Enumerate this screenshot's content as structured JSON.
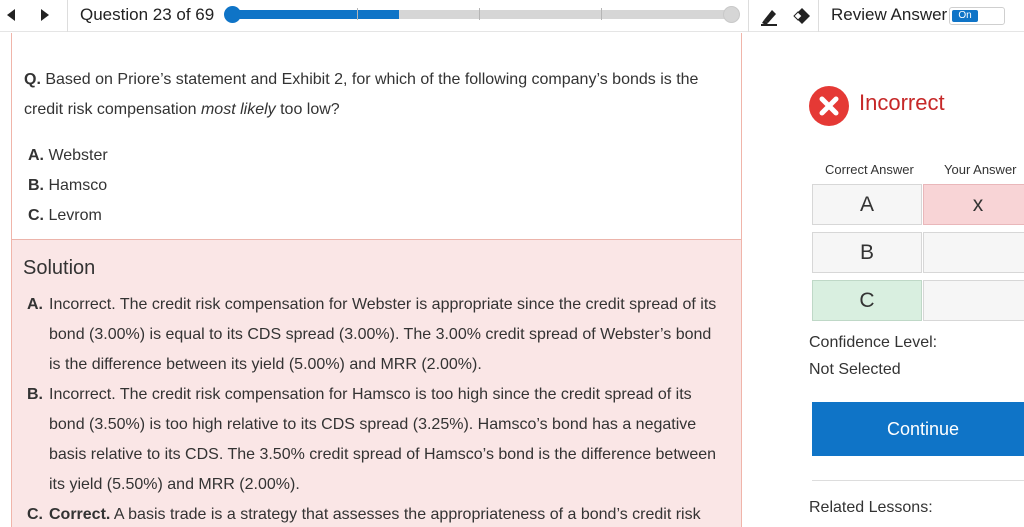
{
  "topbar": {
    "question_counter": "Question 23 of 69",
    "progress": {
      "current": 23,
      "total": 69
    },
    "icons": [
      "prev-arrow-icon",
      "next-arrow-icon",
      "highlighter-icon",
      "eraser-icon"
    ],
    "review_label": "Review Answer",
    "toggle_label": "On"
  },
  "question": {
    "prefix": "Q.",
    "text_before": " Based on Priore’s statement and Exhibit 2, for which of the following company’s bonds is the credit risk compensation ",
    "emphasis": "most likely",
    "text_after": " too low?"
  },
  "options": [
    {
      "letter": "A.",
      "text": " Webster"
    },
    {
      "letter": "B.",
      "text": " Hamsco"
    },
    {
      "letter": "C.",
      "text": " Levrom"
    }
  ],
  "solution": {
    "title": "Solution",
    "items": [
      {
        "letter": "A.",
        "text": "Incorrect. The credit risk compensation for Webster is appropriate since the credit spread of its bond (3.00%) is equal to its CDS spread (3.00%). The 3.00% credit spread of Webster’s bond is the difference between its yield (5.00%) and MRR (2.00%)."
      },
      {
        "letter": "B.",
        "text": "Incorrect. The credit risk compensation for Hamsco is too high since the credit spread of its bond (3.50%) is too high relative to its CDS spread (3.25%). Hamsco’s bond has a negative basis relative to its CDS. The 3.50% credit spread of Hamsco’s bond is the difference between its yield (5.50%) and MRR (2.00%)."
      },
      {
        "letter": "C.",
        "strong": "Correct.",
        "text": " A basis trade is a strategy that assesses the appropriateness of a bond’s credit risk"
      }
    ]
  },
  "result": {
    "label": "Incorrect",
    "icon": "x-circle-icon",
    "correct_header": "Correct Answer",
    "your_header": "Your Answer",
    "rows": [
      {
        "correct": "A",
        "your": "x"
      },
      {
        "correct": "B",
        "your": ""
      },
      {
        "correct": "C",
        "your": ""
      }
    ],
    "confidence_label": "Confidence Level:",
    "confidence_value": "Not Selected",
    "continue_label": "Continue",
    "related_label": "Related Lessons:"
  },
  "colors": {
    "accent": "#0f74c7",
    "incorrect": "#c62828",
    "incorrect_icon": "#e53935",
    "correct_bg": "#d9efe0",
    "wrong_bg": "#f8d4d6",
    "solution_bg": "#fae6e6"
  }
}
